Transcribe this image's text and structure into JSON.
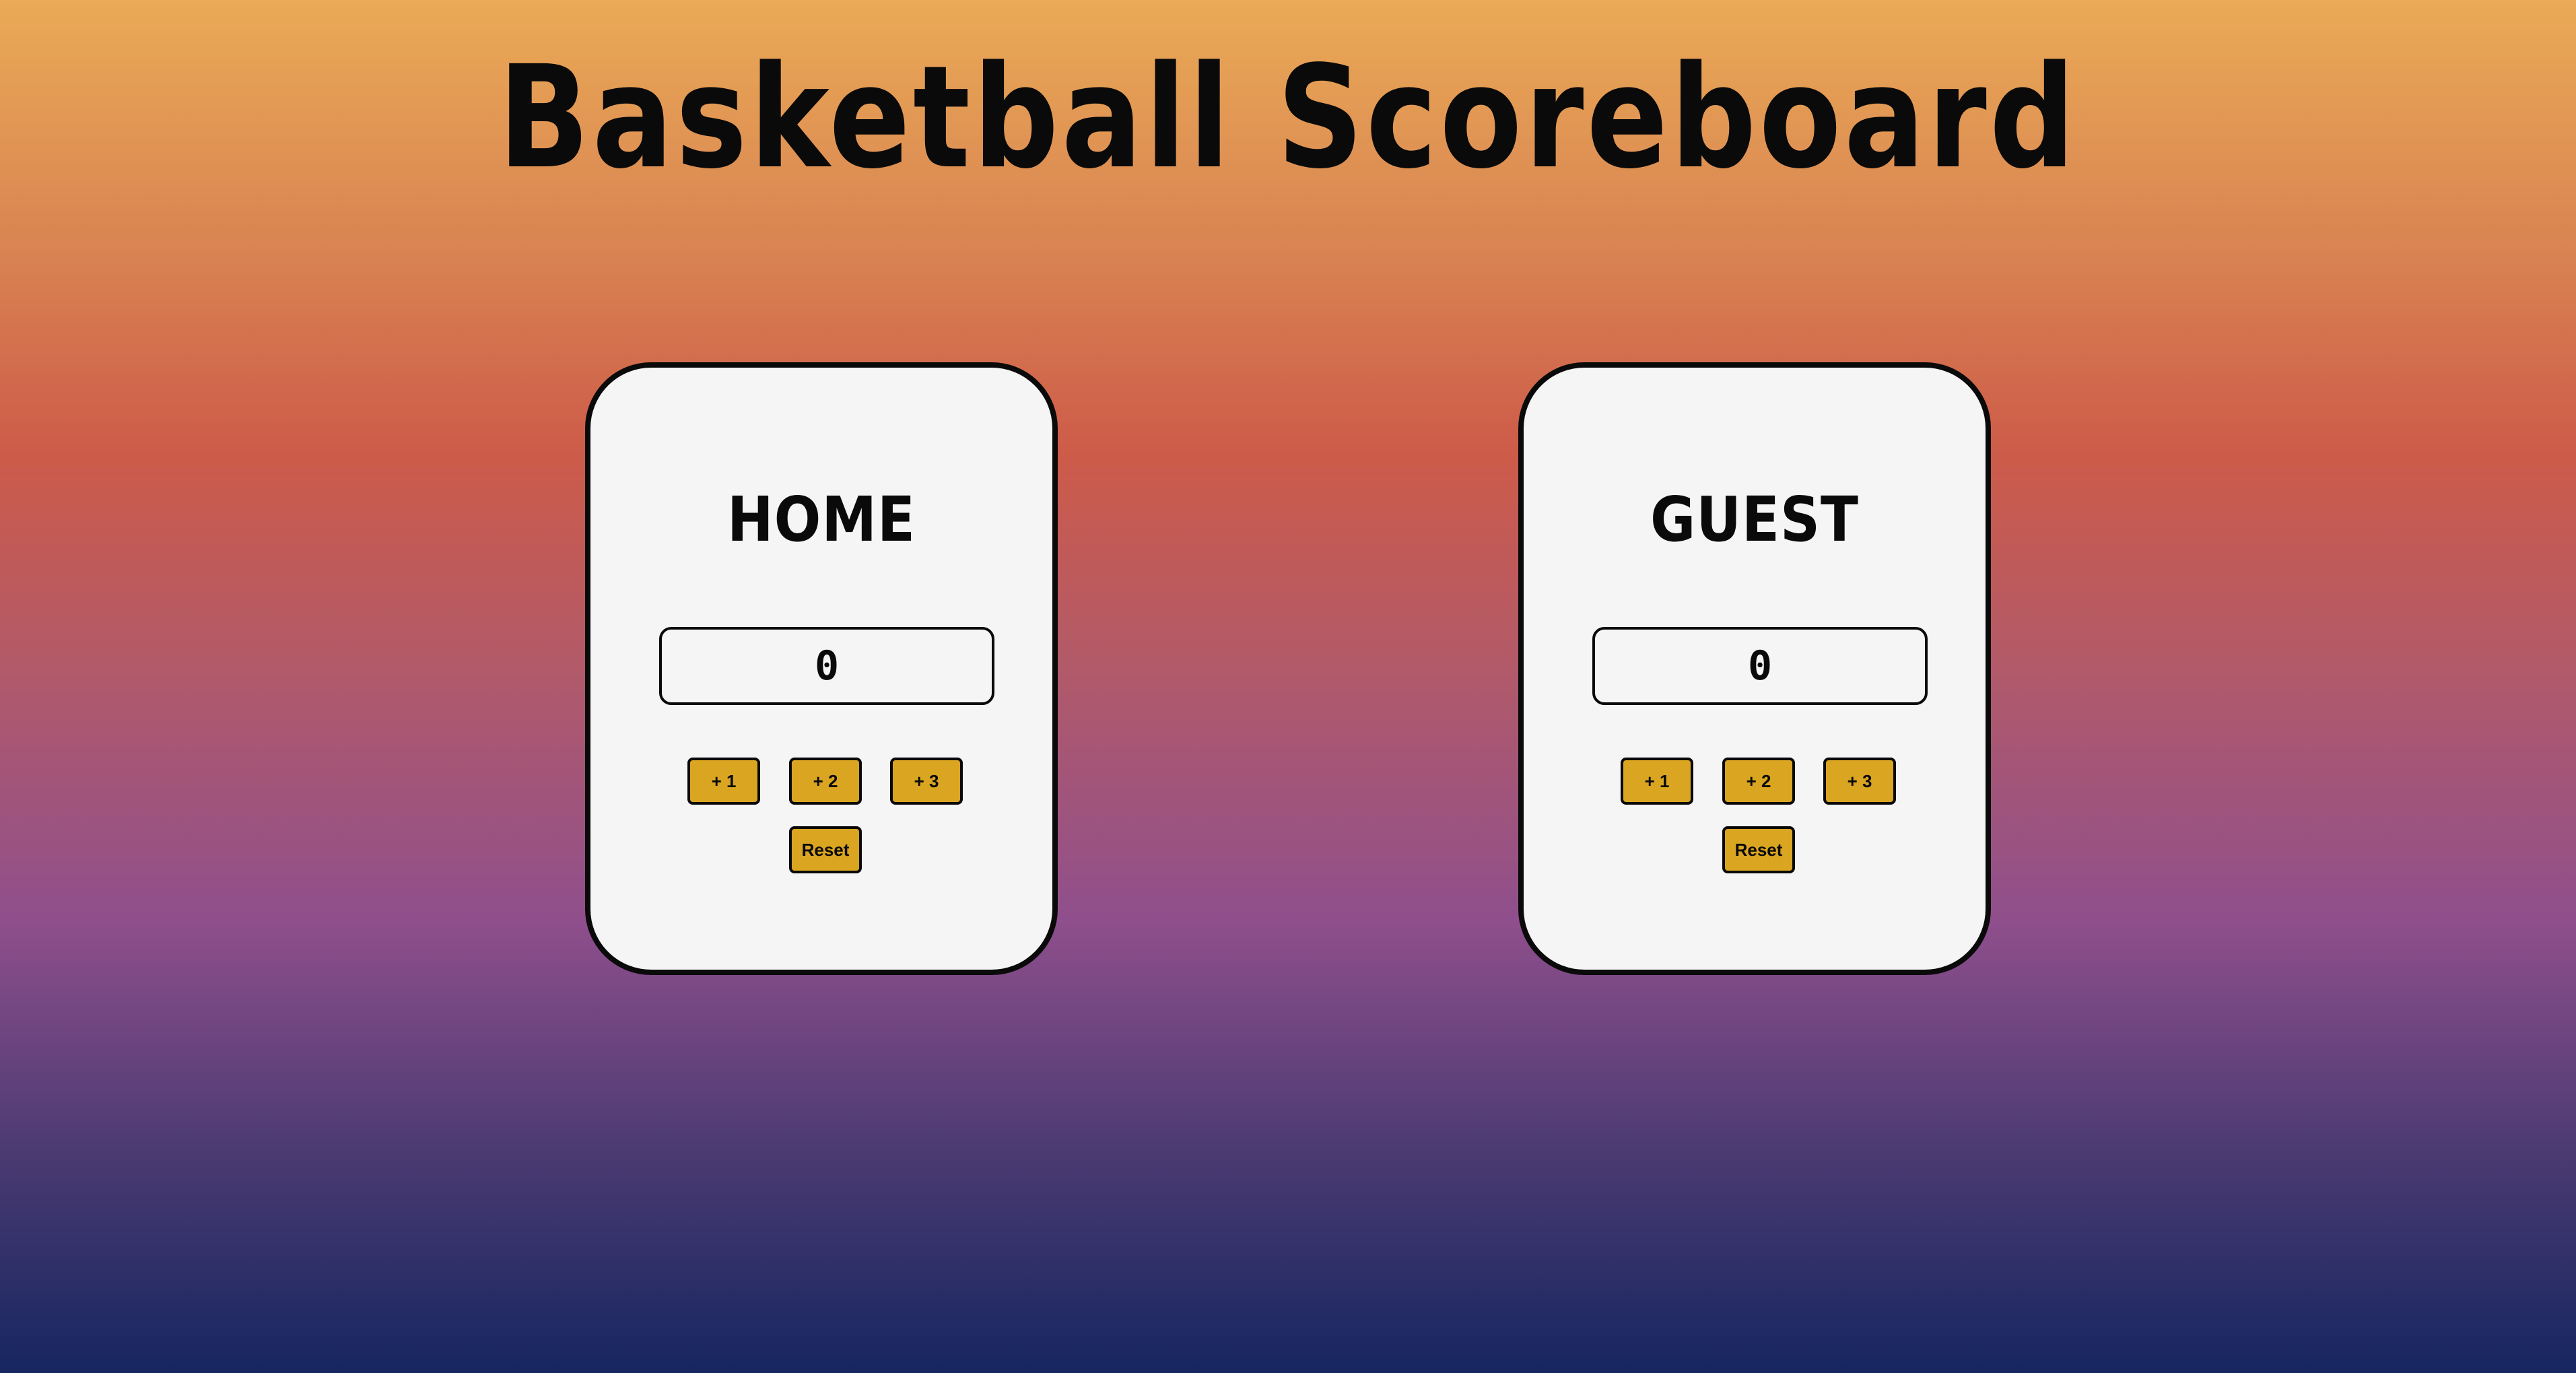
{
  "title": "Basketball Scoreboard",
  "colors": {
    "card_background": "#f5f5f5",
    "button_background": "#daa520",
    "text": "#0a0a0a",
    "gradient_top": "#eaaa56",
    "gradient_mid": "#cd5b49",
    "gradient_purple": "#8f4f8c",
    "gradient_bottom": "#162660"
  },
  "home": {
    "name": "HOME",
    "score": "0",
    "buttons": {
      "plus1": "+ 1",
      "plus2": "+ 2",
      "plus3": "+ 3",
      "reset": "Reset"
    }
  },
  "guest": {
    "name": "GUEST",
    "score": "0",
    "buttons": {
      "plus1": "+ 1",
      "plus2": "+ 2",
      "plus3": "+ 3",
      "reset": "Reset"
    }
  }
}
